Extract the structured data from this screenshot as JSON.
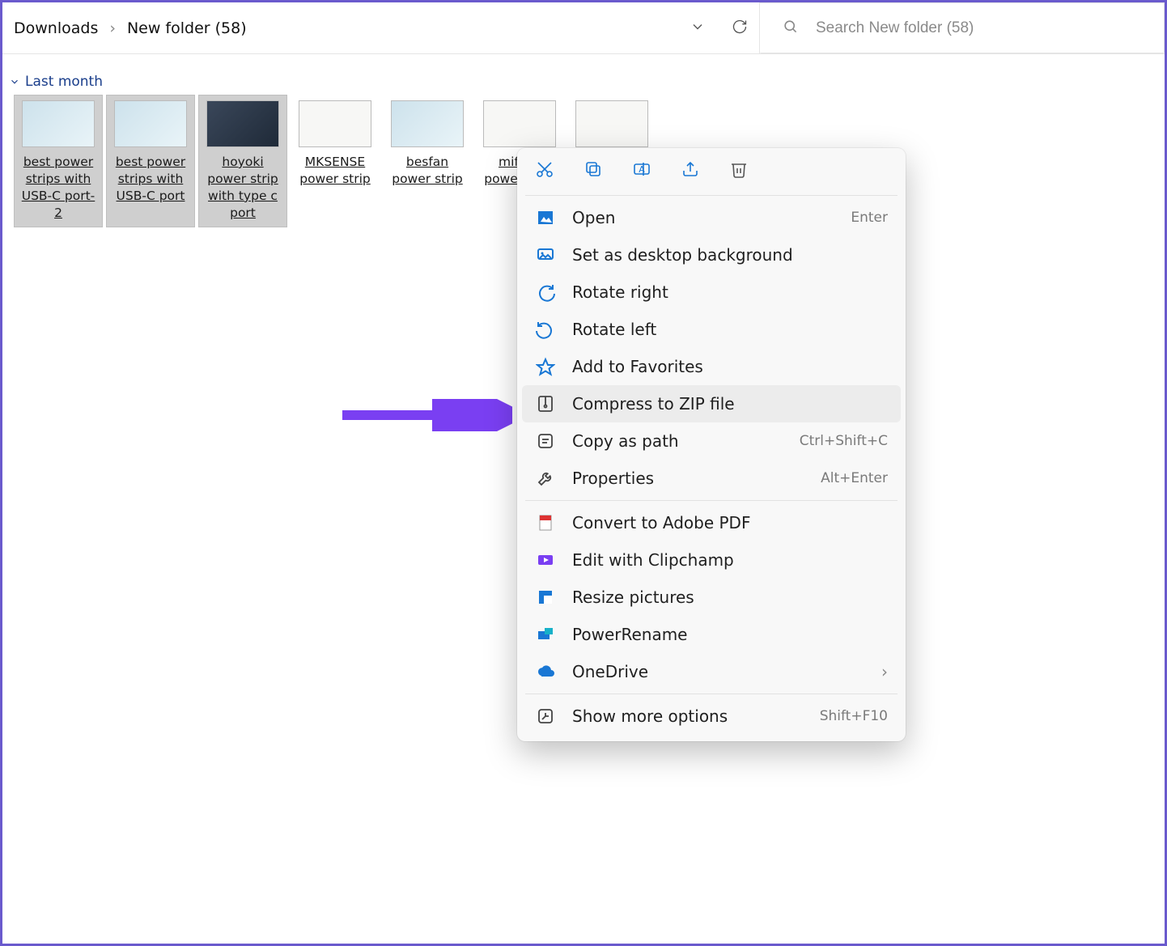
{
  "breadcrumb": {
    "root": "Downloads",
    "current": "New folder (58)"
  },
  "search": {
    "placeholder": "Search New folder (58)"
  },
  "group": {
    "label": "Last month"
  },
  "files": [
    {
      "label": "best power strips with USB-C port-2",
      "selected": true,
      "thumb": "light"
    },
    {
      "label": "best power strips with USB-C port",
      "selected": true,
      "thumb": "light"
    },
    {
      "label": "hoyoki power strip with type c port",
      "selected": true,
      "thumb": "dark"
    },
    {
      "label": "MKSENSE power strip",
      "selected": false,
      "thumb": "white"
    },
    {
      "label": "besfan power strip",
      "selected": false,
      "thumb": "light"
    },
    {
      "label": "mifaso power strip",
      "selected": false,
      "thumb": "white"
    },
    {
      "label": "",
      "selected": false,
      "thumb": "white"
    }
  ],
  "context_menu": {
    "open": "Open",
    "open_shortcut": "Enter",
    "desktop_bg": "Set as desktop background",
    "rotate_right": "Rotate right",
    "rotate_left": "Rotate left",
    "add_fav": "Add to Favorites",
    "compress": "Compress to ZIP file",
    "copy_path": "Copy as path",
    "copy_path_shortcut": "Ctrl+Shift+C",
    "properties": "Properties",
    "properties_shortcut": "Alt+Enter",
    "convert_pdf": "Convert to Adobe PDF",
    "clipchamp": "Edit with Clipchamp",
    "resize": "Resize pictures",
    "power_rename": "PowerRename",
    "onedrive": "OneDrive",
    "more": "Show more options",
    "more_shortcut": "Shift+F10"
  }
}
